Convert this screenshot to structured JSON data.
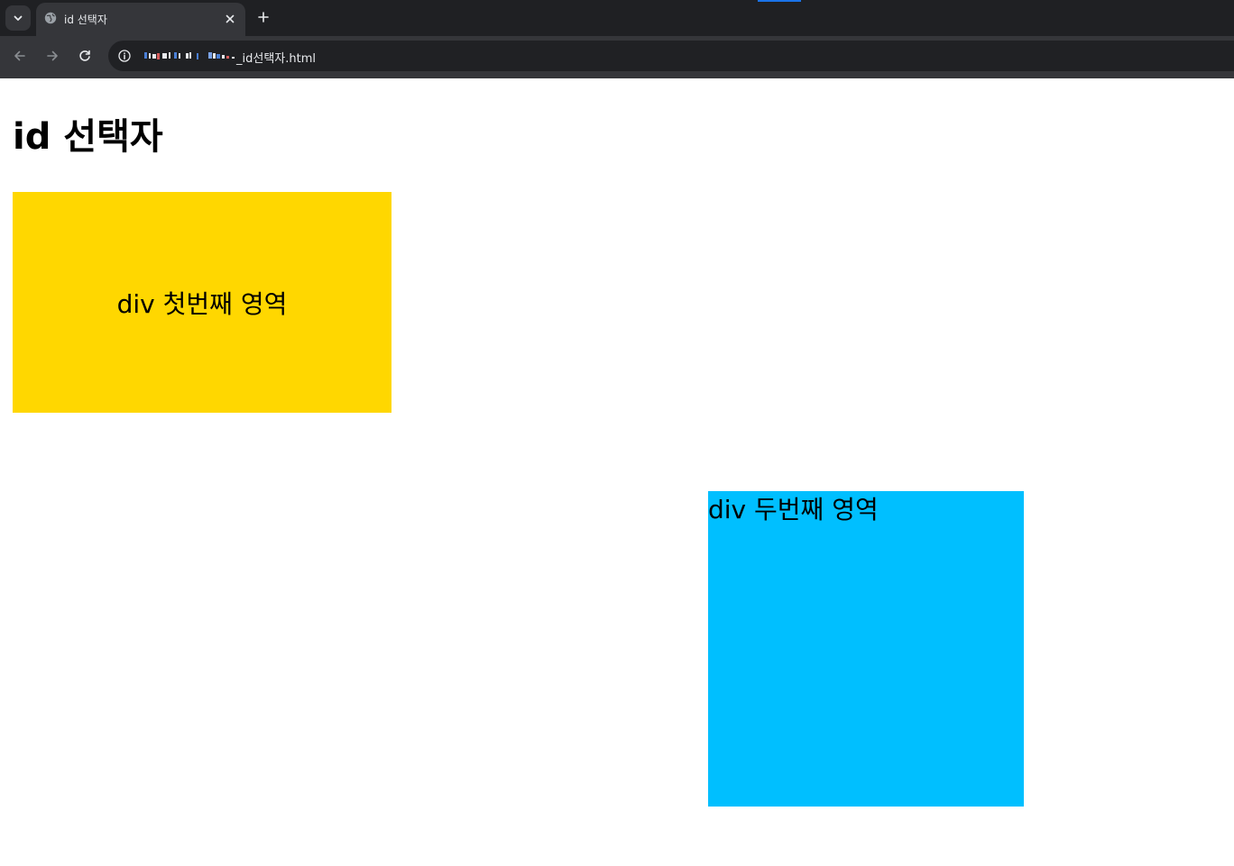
{
  "browser": {
    "tab": {
      "title": "id 선택자",
      "close_icon": "close-icon",
      "favicon": "globe-icon"
    },
    "new_tab_icon": "plus-icon",
    "tab_search_icon": "chevron-down-icon",
    "toolbar": {
      "back_icon": "arrow-left-icon",
      "forward_icon": "arrow-right-icon",
      "reload_icon": "reload-icon",
      "site_info_icon": "info-icon"
    },
    "address_bar": {
      "url_visible": "_id선택자.html"
    },
    "colors": {
      "chrome_bg": "#202124",
      "toolbar_bg": "#35363a",
      "accent": "#1a73e8"
    }
  },
  "page": {
    "heading": "id 선택자",
    "first_box": {
      "text": "div 첫번째 영역",
      "color": "#ffd700"
    },
    "second_box": {
      "text": "div 두번째 영역",
      "color": "#00bfff"
    }
  }
}
